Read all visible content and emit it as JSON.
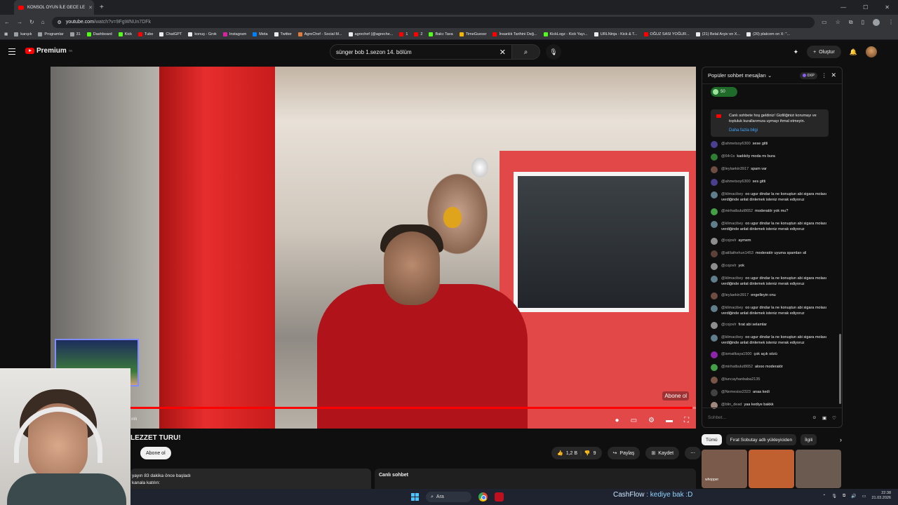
{
  "browser": {
    "tab_title": "KONSOL OYUN İLE GECE LE",
    "url_host": "youtube.com",
    "url_path": "/watch?v=9FgWNUn7DFk",
    "bookmarks": [
      {
        "label": "karışık",
        "color": "#9aa0a6"
      },
      {
        "label": "Programlar",
        "color": "#9aa0a6"
      },
      {
        "label": "31",
        "color": "#9aa0a6"
      },
      {
        "label": "Dashboard",
        "color": "#53fc18"
      },
      {
        "label": "Kick",
        "color": "#53fc18"
      },
      {
        "label": "Tube",
        "color": "#ff0000"
      },
      {
        "label": "ChatGPT",
        "color": "#e8eaed"
      },
      {
        "label": "konuş - Grok",
        "color": "#e8eaed"
      },
      {
        "label": "Instagram",
        "color": "#d6249f"
      },
      {
        "label": "Meta",
        "color": "#0081fb"
      },
      {
        "label": "Twitter",
        "color": "#e8eaed"
      },
      {
        "label": "AgreChef - Social M...",
        "color": "#e07b39"
      },
      {
        "label": "agrechef (@agreche...",
        "color": "#e8eaed"
      },
      {
        "label": "1",
        "color": "#ff0000"
      },
      {
        "label": "2",
        "color": "#ff0000"
      },
      {
        "label": "Balcı Tava",
        "color": "#53fc18"
      },
      {
        "label": "TimeGuessr",
        "color": "#f4b400"
      },
      {
        "label": "İnsanlık Tarihini Değ...",
        "color": "#ff0000"
      },
      {
        "label": "KickLogz - Kick Yayı...",
        "color": "#53fc18"
      },
      {
        "label": "URLNinja - Kick & T...",
        "color": "#e8eaed"
      },
      {
        "label": "OĞUZ SASI YOĞUR...",
        "color": "#ff0000"
      },
      {
        "label": "(21) Belal Arşiv on X...",
        "color": "#e8eaed"
      },
      {
        "label": "(20) platcom on X: \"...",
        "color": "#e8eaed"
      }
    ]
  },
  "header": {
    "logo_text": "Premium",
    "logo_region": "TR",
    "search_value": "sünger bob 1.sezon 14. bölüm",
    "create_label": "Oluştur"
  },
  "video": {
    "title": "LEZZET TURU!",
    "progress_fraction": 0.995,
    "watermark": "Abone ol",
    "time_fragment": "ırılı"
  },
  "channel": {
    "subscribe_label": "Abone ol"
  },
  "actions": {
    "likes": "1,2 B",
    "dislikes": "9",
    "share_label": "Paylaş",
    "save_label": "Kaydet"
  },
  "description": {
    "line1": "yayın 83 dakika önce başladı",
    "line2": "kanala katılın:"
  },
  "chat_below": {
    "title": "Canlı sohbet"
  },
  "chat": {
    "header_title": "Popüler sohbet mesajları",
    "xp_label": "0XP",
    "pinned_count": "50",
    "welcome_text": "Canlı sohbete hoş geldiniz! Gizliliğinizi korumayı ve topluluk kurallarımıza uymayı ihmal etmeyin.",
    "welcome_link": "Daha fazla bilgi",
    "input_placeholder": "Sohbet...",
    "messages": [
      {
        "user": "@ahmetsoy6300",
        "text": "sese gitti",
        "color": "#4a3f8f"
      },
      {
        "user": "@64r1s",
        "text": "kadıköy moda mı bura",
        "color": "#2e7d32"
      },
      {
        "user": "@leylaekin3917",
        "text": "spam var",
        "color": "#6d4c41"
      },
      {
        "user": "@ahmetsoy6300",
        "text": "ses gitti",
        "color": "#4a3f8f"
      },
      {
        "user": "@klimacibey",
        "text": "oo ugur dindar la ne konuştun abi sigara molası verdiğinde anlat dinlemek isteniz merak ediyoruz",
        "color": "#607d8b"
      },
      {
        "user": "@mirhatbulut8652",
        "text": "moderatör yok mu?",
        "color": "#43a047"
      },
      {
        "user": "@klimacibey",
        "text": "oo ugur dindar la ne konuştun abi sigara molası verdiğinde anlat dinlemek isteniz merak ediyoruz",
        "color": "#607d8b"
      },
      {
        "user": "@cojovlr",
        "text": "aymem",
        "color": "#8d8d8d"
      },
      {
        "user": "@atillathehun1453",
        "text": "moderatör uyuma spamları sil",
        "color": "#5d4037"
      },
      {
        "user": "@cojovlr",
        "text": "yok",
        "color": "#8d8d8d"
      },
      {
        "user": "@klimacibey",
        "text": "oo ugur dindar la ne konuştun abi sigara molası verdiğinde anlat dinlemek isteniz merak ediyoruz",
        "color": "#607d8b"
      },
      {
        "user": "@leylaekin3917",
        "text": "engelleyin onu",
        "color": "#6d4c41"
      },
      {
        "user": "@klimacibey",
        "text": "oo ugur dindar la ne konuştun abi sigara molası verdiğinde anlat dinlemek isteniz merak ediyoruz",
        "color": "#607d8b"
      },
      {
        "user": "@cojovlr",
        "text": "fırat abi selamlar",
        "color": "#8d8d8d"
      },
      {
        "user": "@klimacibey",
        "text": "oo ugur dindar la ne konuştun abi sigara molası verdiğinde anlat dinlemek isteniz merak ediyoruz",
        "color": "#607d8b"
      },
      {
        "user": "@ismailkaya1500",
        "text": "çok açık sözü",
        "color": "#8e24aa"
      },
      {
        "user": "@mirhatbulut8652",
        "text": "alooo moderatör",
        "color": "#43a047"
      },
      {
        "user": "@tuncayhanbaba2135",
        "text": "",
        "color": "#795548"
      },
      {
        "user": "@Nemesiss2323",
        "text": "anaa kedi",
        "color": "#424242"
      },
      {
        "user": "@blin_dead",
        "text": "yaa kediye bakkk",
        "color": "#a1887f"
      }
    ]
  },
  "chips": {
    "all": "Tümü",
    "channel": "Fırat Sobutay adlı yükleyiciden",
    "related": "İlgili"
  },
  "thumbs": [
    {
      "label": "whopper",
      "color": "#7a5a4a"
    },
    {
      "label": "",
      "color": "#c06030"
    },
    {
      "label": "",
      "color": "#6a5a50"
    }
  ],
  "taskbar": {
    "search_label": "Ara",
    "overlay_prefix": "CashFlow",
    "overlay_text": ": kediye bak :D",
    "time": "22:38",
    "date": "21.03.2026"
  }
}
